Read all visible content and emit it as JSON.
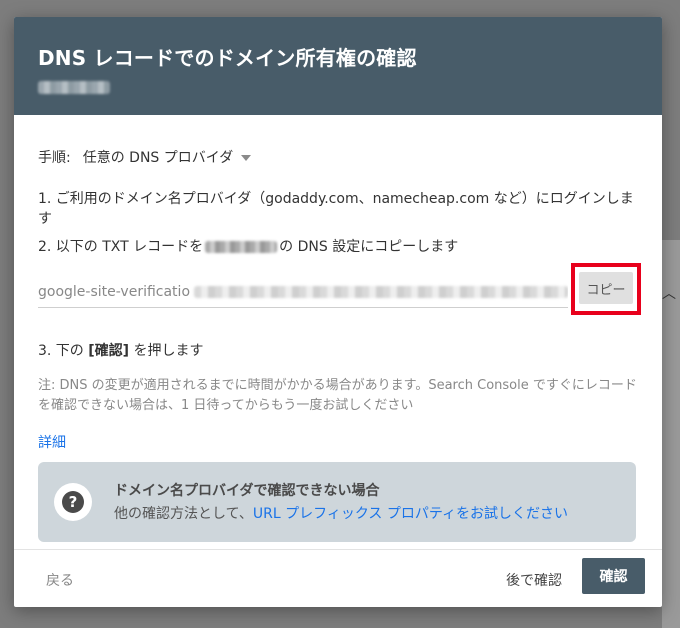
{
  "dialog": {
    "title": "DNS レコードでのドメイン所有権の確認"
  },
  "step": {
    "label": "手順:",
    "provider_value": "任意の DNS プロバイダ"
  },
  "instructions": {
    "line1": "1. ご利用のドメイン名プロバイダ（godaddy.com、namecheap.com など）にログインします",
    "line2_prefix": "2. 以下の TXT レコードを",
    "line2_suffix": "の DNS 設定にコピーします",
    "line3_prefix": "3. 下の ",
    "line3_bold": "[確認]",
    "line3_suffix": " を押します"
  },
  "txt_record": {
    "prefix": "google-site-verificatio",
    "copy_label": "コピー"
  },
  "note": "注: DNS の変更が適用されるまでに時間がかかる場合があります。Search Console ですぐにレコードを確認できない場合は、1 日待ってからもう一度お試しください",
  "details_link": "詳細",
  "info_card": {
    "title": "ドメイン名プロバイダで確認できない場合",
    "text_prefix": "他の確認方法として、",
    "link": "URL プレフィックス プロパティをお試しください"
  },
  "footer": {
    "back_label": "戻る",
    "later_label": "後で確認",
    "confirm_label": "確認"
  },
  "colors": {
    "header_bg": "#485c69",
    "link": "#1a73e8",
    "highlight": "#e8001c",
    "info_card_bg": "#ced6db"
  },
  "icons": {
    "provider_dropdown": "caret-down-icon",
    "help": "help-icon"
  }
}
